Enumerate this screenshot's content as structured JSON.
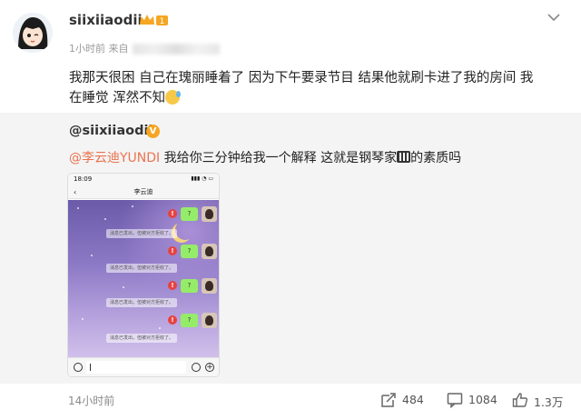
{
  "post": {
    "username": "siixiiaodii",
    "vip_level": "1",
    "time": "1小时前",
    "source_prefix": "来自",
    "text_line1": "我那天很困 自己在瑰丽睡着了 因为下午要录节目 结果他就刷卡进了我的房间 我",
    "text_line2": "在睡觉 浑然不知"
  },
  "repost": {
    "username": "@siixiiaodii",
    "mention": "@李云迪YUNDI",
    "text_a": " 我给你三分钟给我一个解释 这就是钢琴家",
    "text_b": "的素质吗",
    "screenshot": {
      "status_time": "18:09",
      "status_icons": "▮▮▮ ◔ ▭",
      "back": "‹",
      "contact": "李云迪",
      "bubble_text": "?",
      "error_mark": "!",
      "notice": "消息已发出，但被对方拒收了。"
    }
  },
  "footer": {
    "time": "14小时前",
    "reposts": "484",
    "comments": "1084",
    "likes": "1.3万"
  },
  "colors": {
    "mention": "#eb7350",
    "wechat_bubble": "#95ec69",
    "error_red": "#e64340",
    "repost_bg": "#f4f4f4"
  }
}
